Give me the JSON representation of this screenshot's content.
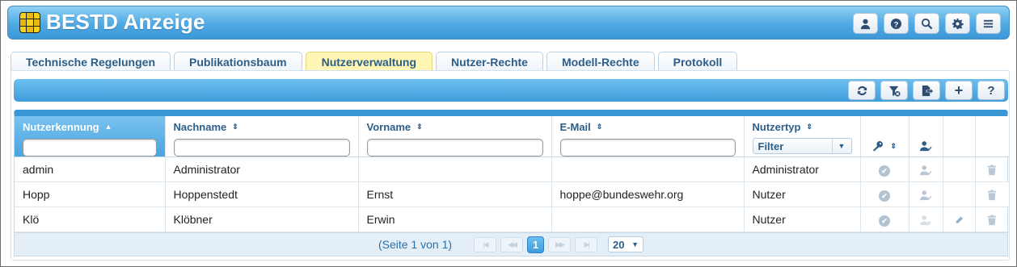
{
  "app": {
    "title": "BESTD Anzeige"
  },
  "header_buttons": [
    {
      "icon": "user-icon"
    },
    {
      "icon": "help-icon"
    },
    {
      "icon": "search-icon"
    },
    {
      "icon": "gear-icon"
    },
    {
      "icon": "menu-icon"
    }
  ],
  "tabs": [
    {
      "label": "Technische Regelungen"
    },
    {
      "label": "Publikationsbaum"
    },
    {
      "label": "Nutzerverwaltung",
      "active": true
    },
    {
      "label": "Nutzer-Rechte"
    },
    {
      "label": "Modell-Rechte"
    },
    {
      "label": "Protokoll"
    }
  ],
  "toolbar": {
    "help_label": "?",
    "add_label": "+"
  },
  "columns": {
    "nutzerkennung": "Nutzerkennung",
    "nachname": "Nachname",
    "vorname": "Vorname",
    "email": "E-Mail",
    "nutzertyp": "Nutzertyp",
    "nutzertyp_filter": "Filter"
  },
  "rows": [
    {
      "kennung": "admin",
      "nachname": "Administrator",
      "vorname": "",
      "email": "",
      "typ": "Administrator",
      "edit": false
    },
    {
      "kennung": "Hopp",
      "nachname": "Hoppenstedt",
      "vorname": "Ernst",
      "email": "hoppe@bundeswehr.org",
      "typ": "Nutzer",
      "edit": false
    },
    {
      "kennung": "Klö",
      "nachname": "Klöbner",
      "vorname": "Erwin",
      "email": "",
      "typ": "Nutzer",
      "edit": true
    }
  ],
  "pager": {
    "info": "(Seite 1 von 1)",
    "current_page": "1",
    "page_size": "20"
  },
  "colors": {
    "accent": "#3a98d8",
    "active_tab": "#fff6b5",
    "text_blue": "#2d5e88"
  }
}
